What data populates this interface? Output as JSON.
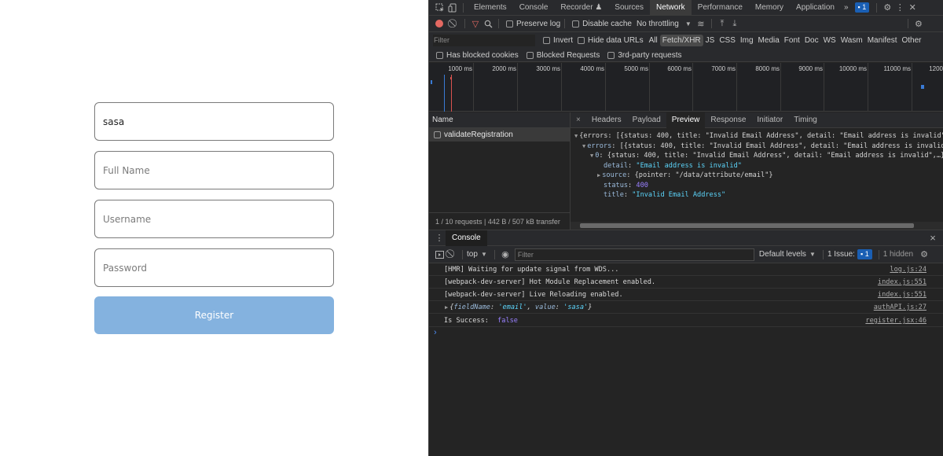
{
  "form": {
    "email_value": "sasa",
    "fullname_placeholder": "Full Name",
    "username_placeholder": "Username",
    "password_placeholder": "Password",
    "register_label": "Register",
    "register_color": "#84b2df"
  },
  "devtools": {
    "tabs": [
      "Elements",
      "Console",
      "Recorder",
      "Sources",
      "Network",
      "Performance",
      "Memory",
      "Application"
    ],
    "active_tab": "Network",
    "more_tabs": "»",
    "issue_count": "1",
    "toolbar": {
      "preserve_log": "Preserve log",
      "disable_cache": "Disable cache",
      "throttling": "No throttling"
    },
    "filter": {
      "placeholder": "Filter",
      "invert": "Invert",
      "hide_data_urls": "Hide data URLs",
      "types": [
        "All",
        "Fetch/XHR",
        "JS",
        "CSS",
        "Img",
        "Media",
        "Font",
        "Doc",
        "WS",
        "Wasm",
        "Manifest",
        "Other"
      ],
      "active_type": "Fetch/XHR",
      "has_blocked_cookies": "Has blocked cookies",
      "blocked_requests": "Blocked Requests",
      "third_party": "3rd-party requests"
    },
    "timeline_ticks": [
      "1000 ms",
      "2000 ms",
      "3000 ms",
      "4000 ms",
      "5000 ms",
      "6000 ms",
      "7000 ms",
      "8000 ms",
      "9000 ms",
      "10000 ms",
      "11000 ms",
      "1200"
    ],
    "requests": {
      "name_header": "Name",
      "items": [
        "validateRegistration"
      ],
      "summary": "1 / 10 requests | 442 B / 507 kB transfer"
    },
    "detail_tabs": [
      "Headers",
      "Payload",
      "Preview",
      "Response",
      "Initiator",
      "Timing"
    ],
    "active_detail_tab": "Preview",
    "close_glyph": "×",
    "preview": {
      "line1": "{errors: [{status: 400, title: \"Invalid Email Address\", detail: \"Email address is invalid\"",
      "line2_key": "errors",
      "line2_rest": ": [{status: 400, title: \"Invalid Email Address\", detail: \"Email address is invalid",
      "line3_key": "0",
      "line3_rest": ": {status: 400, title: \"Invalid Email Address\", detail: \"Email address is invalid\",…}",
      "detail_key": "detail",
      "detail_val": "\"Email address is invalid\"",
      "source_key": "source",
      "source_val": "{pointer: \"/data/attribute/email\"}",
      "status_key": "status",
      "status_val": "400",
      "title_key": "title",
      "title_val": "\"Invalid Email Address\""
    },
    "console": {
      "tab": "Console",
      "context": "top",
      "filter_placeholder": "Filter",
      "levels": "Default levels",
      "issues": "1 Issue:",
      "issues_count": "1",
      "hidden": "1 hidden",
      "messages": [
        {
          "text": "[HMR] Waiting for update signal from WDS...",
          "source": "log.js:24"
        },
        {
          "text": "[webpack-dev-server] Hot Module Replacement enabled.",
          "source": "index.js:551"
        },
        {
          "text": "[webpack-dev-server] Live Reloading enabled.",
          "source": "index.js:551"
        },
        {
          "object": {
            "open": "{",
            "k1": "fieldName",
            "sep1": ": ",
            "v1": "'email'",
            "comma": ", ",
            "k2": "value",
            "sep2": ": ",
            "v2": "'sasa'",
            "close": "}"
          },
          "source": "authAPI.js:27"
        },
        {
          "label": "Is Success:",
          "value": "false",
          "source": "register.jsx:46"
        }
      ],
      "prompt": "›"
    }
  }
}
